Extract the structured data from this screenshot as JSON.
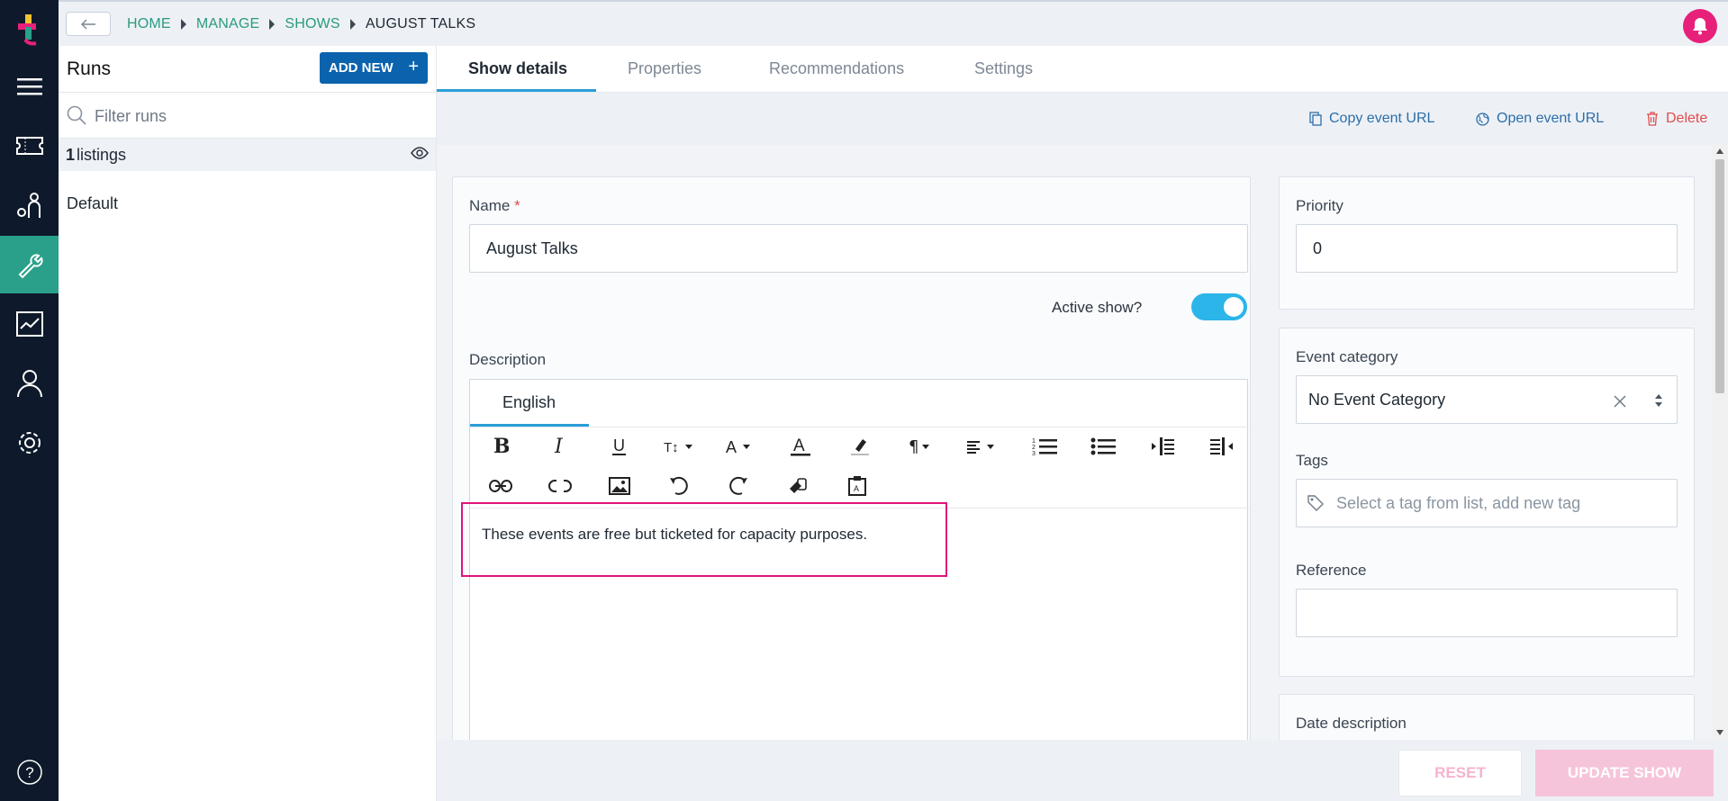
{
  "breadcrumb": {
    "items": [
      "HOME",
      "MANAGE",
      "SHOWS"
    ],
    "current": "AUGUST TALKS"
  },
  "runs": {
    "title": "Runs",
    "add_new_label": "ADD NEW",
    "add_new_icon": "+",
    "filter_placeholder": "Filter runs",
    "listings_count": "1",
    "listings_label": "listings",
    "items": [
      "Default"
    ]
  },
  "tabs": [
    "Show details",
    "Properties",
    "Recommendations",
    "Settings"
  ],
  "actions": {
    "copy_url": "Copy event URL",
    "open_url": "Open event URL",
    "delete": "Delete"
  },
  "form": {
    "name_label": "Name",
    "name_required": "*",
    "name_value": "August Talks",
    "active_label": "Active show?",
    "active_value": true,
    "description_label": "Description",
    "language_tab": "English",
    "description_text": "These events are free but ticketed for capacity purposes.",
    "priority_label": "Priority",
    "priority_value": "0",
    "event_category_label": "Event category",
    "event_category_value": "No Event Category",
    "tags_label": "Tags",
    "tags_placeholder": "Select a tag from list, add new tag",
    "reference_label": "Reference",
    "reference_value": "",
    "date_description_label": "Date description"
  },
  "footer": {
    "reset_label": "RESET",
    "update_label": "UPDATE SHOW"
  },
  "colors": {
    "rail": "#0e1a2b",
    "rail_active": "#2aa08a",
    "primary_button": "#0b63ad",
    "tab_accent": "#2b9ed8",
    "toggle_on": "#2bb5e8",
    "notification": "#e7217a",
    "delete": "#e24c4c",
    "highlight_box": "#e0147a"
  },
  "icons": {
    "rail": [
      "app-logo-icon",
      "menu-icon",
      "ticket-icon",
      "customers-icon",
      "wrench-icon",
      "reports-icon",
      "user-icon",
      "settings-gear-icon",
      "help-icon"
    ],
    "toolbar_row1": [
      "bold-icon",
      "italic-icon",
      "underline-icon",
      "font-size-icon",
      "font-family-icon",
      "text-color-icon",
      "highlight-icon",
      "paragraph-icon",
      "align-icon",
      "ordered-list-icon",
      "unordered-list-icon",
      "outdent-icon",
      "indent-icon"
    ],
    "toolbar_row2": [
      "insert-link-icon",
      "unlink-icon",
      "insert-image-icon",
      "undo-icon",
      "redo-icon",
      "clear-format-icon",
      "paste-icon"
    ]
  }
}
